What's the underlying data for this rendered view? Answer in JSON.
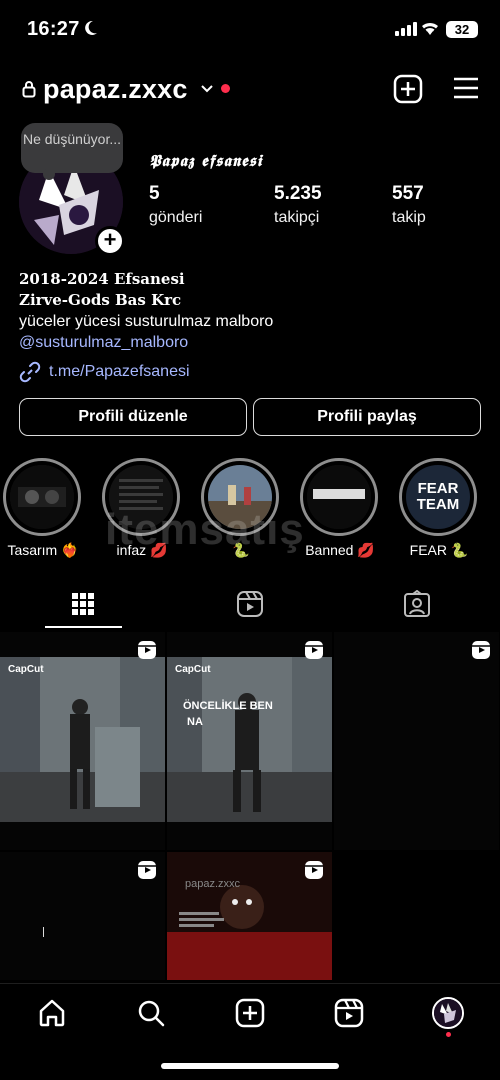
{
  "status_bar": {
    "time": "16:27",
    "battery": "32"
  },
  "profile": {
    "username": "papaz.zxxc",
    "display_name": "𝕻𝖆𝖕𝖆𝖟 𝖊𝖋𝖘𝖆𝖓𝖊𝖘𝖎",
    "note": "Ne düşünüyor...",
    "stats": [
      {
        "value": "5",
        "label": "gönderi"
      },
      {
        "value": "5.235",
        "label": "takipçi"
      },
      {
        "value": "557",
        "label": "takip"
      }
    ],
    "bio": {
      "line1": "2018-2024 Efsanesi",
      "line2": "Zirve-Gods Bas Krc",
      "line3": "yüceler yücesi susturulmaz malboro",
      "mention": "@susturulmaz_malboro",
      "link": "t.me/Papazefsanesi"
    }
  },
  "buttons": {
    "edit": "Profili düzenle",
    "share": "Profili paylaş"
  },
  "highlights": [
    {
      "label": "Tasarım ❤️‍🔥"
    },
    {
      "label": "infaz 💋"
    },
    {
      "label": "🐍"
    },
    {
      "label": "Banned 💋"
    },
    {
      "label": "FEAR 🐍",
      "cover_text": "FEAR TEAM"
    }
  ],
  "watermark": "itemsatış",
  "grid": {
    "capcut_label": "CapCut",
    "post2_text": "ÖNCELİKLE BEN",
    "post2_text_left": "NA",
    "post5_header": "papaz.zxxc"
  },
  "colors": {
    "accent_link": "#a7b8ff",
    "notification_dot": "#ff2e4d",
    "background": "#000000"
  },
  "icons": [
    "lock-icon",
    "chevron-down-icon",
    "create-plus-icon",
    "menu-icon",
    "link-icon",
    "grid-icon",
    "reels-icon",
    "tagged-icon",
    "home-icon",
    "search-icon",
    "reels-nav-icon"
  ]
}
